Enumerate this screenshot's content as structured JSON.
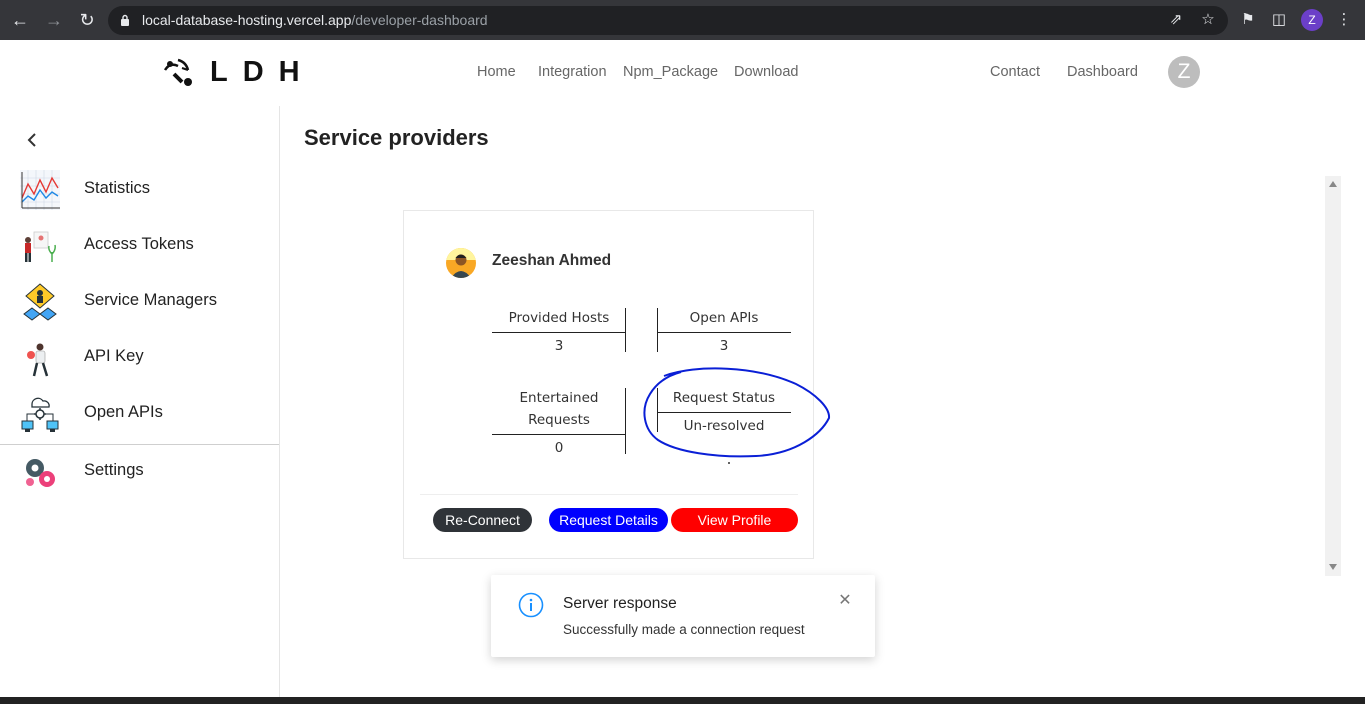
{
  "browser": {
    "url_host": "local-database-hosting.vercel.app",
    "url_path": "/developer-dashboard",
    "profile_initial": "Z"
  },
  "topnav": {
    "logo_text": "LDH",
    "links": [
      "Home",
      "Integration",
      "Npm_Package",
      "Download"
    ],
    "right_links": [
      "Contact",
      "Dashboard"
    ],
    "avatar_initial": "Z"
  },
  "sidebar": {
    "items": [
      {
        "label": "Statistics",
        "icon": "statistics-chart-icon"
      },
      {
        "label": "Access Tokens",
        "icon": "access-tokens-icon"
      },
      {
        "label": "Service Managers",
        "icon": "service-managers-icon"
      },
      {
        "label": "API Key",
        "icon": "api-key-icon"
      },
      {
        "label": "Open APIs",
        "icon": "open-apis-icon"
      },
      {
        "label": "Settings",
        "icon": "settings-gears-icon"
      }
    ]
  },
  "main": {
    "title": "Service providers",
    "card": {
      "name": "Zeeshan Ahmed",
      "stats": [
        {
          "label": "Provided Hosts",
          "value": "3"
        },
        {
          "label": "Open APIs",
          "value": "3"
        },
        {
          "label": "Entertained Requests",
          "value": "0"
        },
        {
          "label": "Request Status",
          "value": "Un-resolved"
        }
      ],
      "buttons": {
        "reconnect": "Re-Connect",
        "details": "Request Details",
        "profile": "View Profile"
      }
    }
  },
  "toast": {
    "title": "Server response",
    "message": "Successfully made a connection request"
  },
  "colors": {
    "reconnect": "#2f3338",
    "details": "#0000ff",
    "profile": "#ff0000",
    "annotation": "#0a1fd6"
  }
}
